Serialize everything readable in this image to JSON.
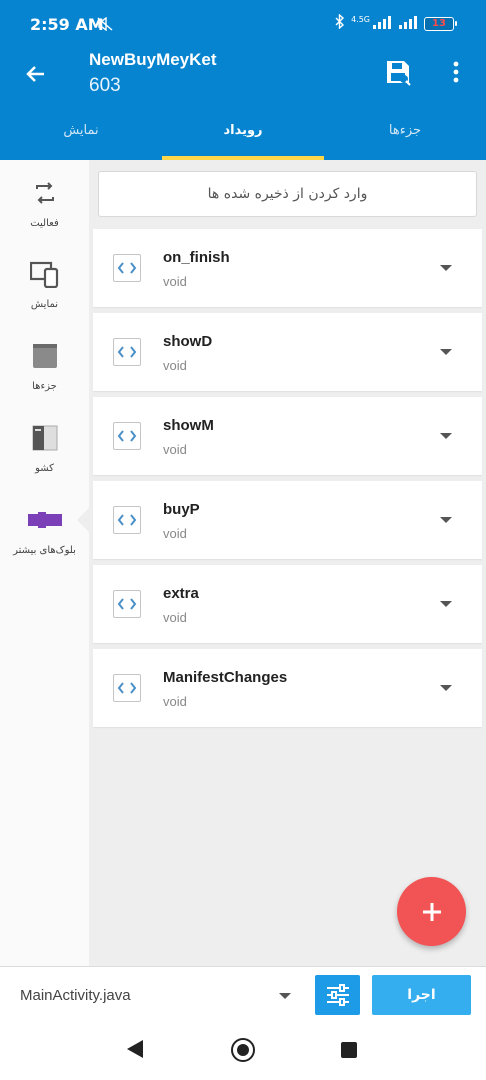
{
  "status_bar": {
    "time": "2:59 AM",
    "network": "4.5G",
    "battery": "13"
  },
  "app_bar": {
    "title": "NewBuyMeyKet",
    "subtitle": "603"
  },
  "tabs": [
    {
      "label": "نمایش",
      "active": false
    },
    {
      "label": "رویداد",
      "active": true
    },
    {
      "label": "جزءها",
      "active": false
    }
  ],
  "sidebar": {
    "items": [
      {
        "label": "فعالیت",
        "icon": "refresh-icon"
      },
      {
        "label": "نمایش",
        "icon": "devices-icon"
      },
      {
        "label": "جزءها",
        "icon": "component-icon"
      },
      {
        "label": "کشو",
        "icon": "drawer-icon"
      },
      {
        "label": "بلوک‌های بیشتر",
        "icon": "more-blocks-icon"
      }
    ]
  },
  "search": {
    "placeholder": "وارد کردن از ذخیره شده ها"
  },
  "events": [
    {
      "name": "on_finish",
      "type": "void"
    },
    {
      "name": "showD",
      "type": "void"
    },
    {
      "name": "showM",
      "type": "void"
    },
    {
      "name": "buyP",
      "type": "void"
    },
    {
      "name": "extra",
      "type": "void"
    },
    {
      "name": "ManifestChanges",
      "type": "void"
    }
  ],
  "bottom_bar": {
    "file": "MainActivity.java",
    "run_label": "اجرا"
  },
  "colors": {
    "primary": "#0684cf",
    "accent": "#ffd84a",
    "fab": "#f25354",
    "run": "#34aeee",
    "more_blocks": "#7b3fb8"
  }
}
